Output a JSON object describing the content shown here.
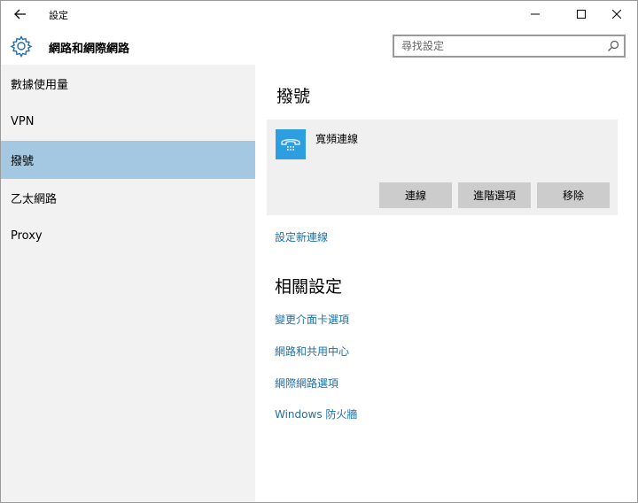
{
  "window": {
    "title": "設定"
  },
  "header": {
    "title": "網路和網際網路",
    "search_placeholder": "尋找設定"
  },
  "sidebar": {
    "items": [
      {
        "label": "數據使用量",
        "active": false
      },
      {
        "label": "VPN",
        "active": false
      },
      {
        "label": "撥號",
        "active": true
      },
      {
        "label": "乙太網路",
        "active": false
      },
      {
        "label": "Proxy",
        "active": false
      }
    ]
  },
  "main": {
    "heading": "撥號",
    "connection": {
      "name": "寬頻連線",
      "buttons": {
        "connect": "連線",
        "advanced": "進階選項",
        "remove": "移除"
      }
    },
    "setup_link": "設定新連線",
    "related_heading": "相關設定",
    "related_links": [
      "變更介面卡選項",
      "網路和共用中心",
      "網際網路選項",
      "Windows 防火牆"
    ]
  },
  "colors": {
    "accent": "#2d9fe0",
    "selected_nav": "#a5c8e2",
    "sidebar_bg": "#f2f2f2",
    "link": "#1e6fa8"
  }
}
